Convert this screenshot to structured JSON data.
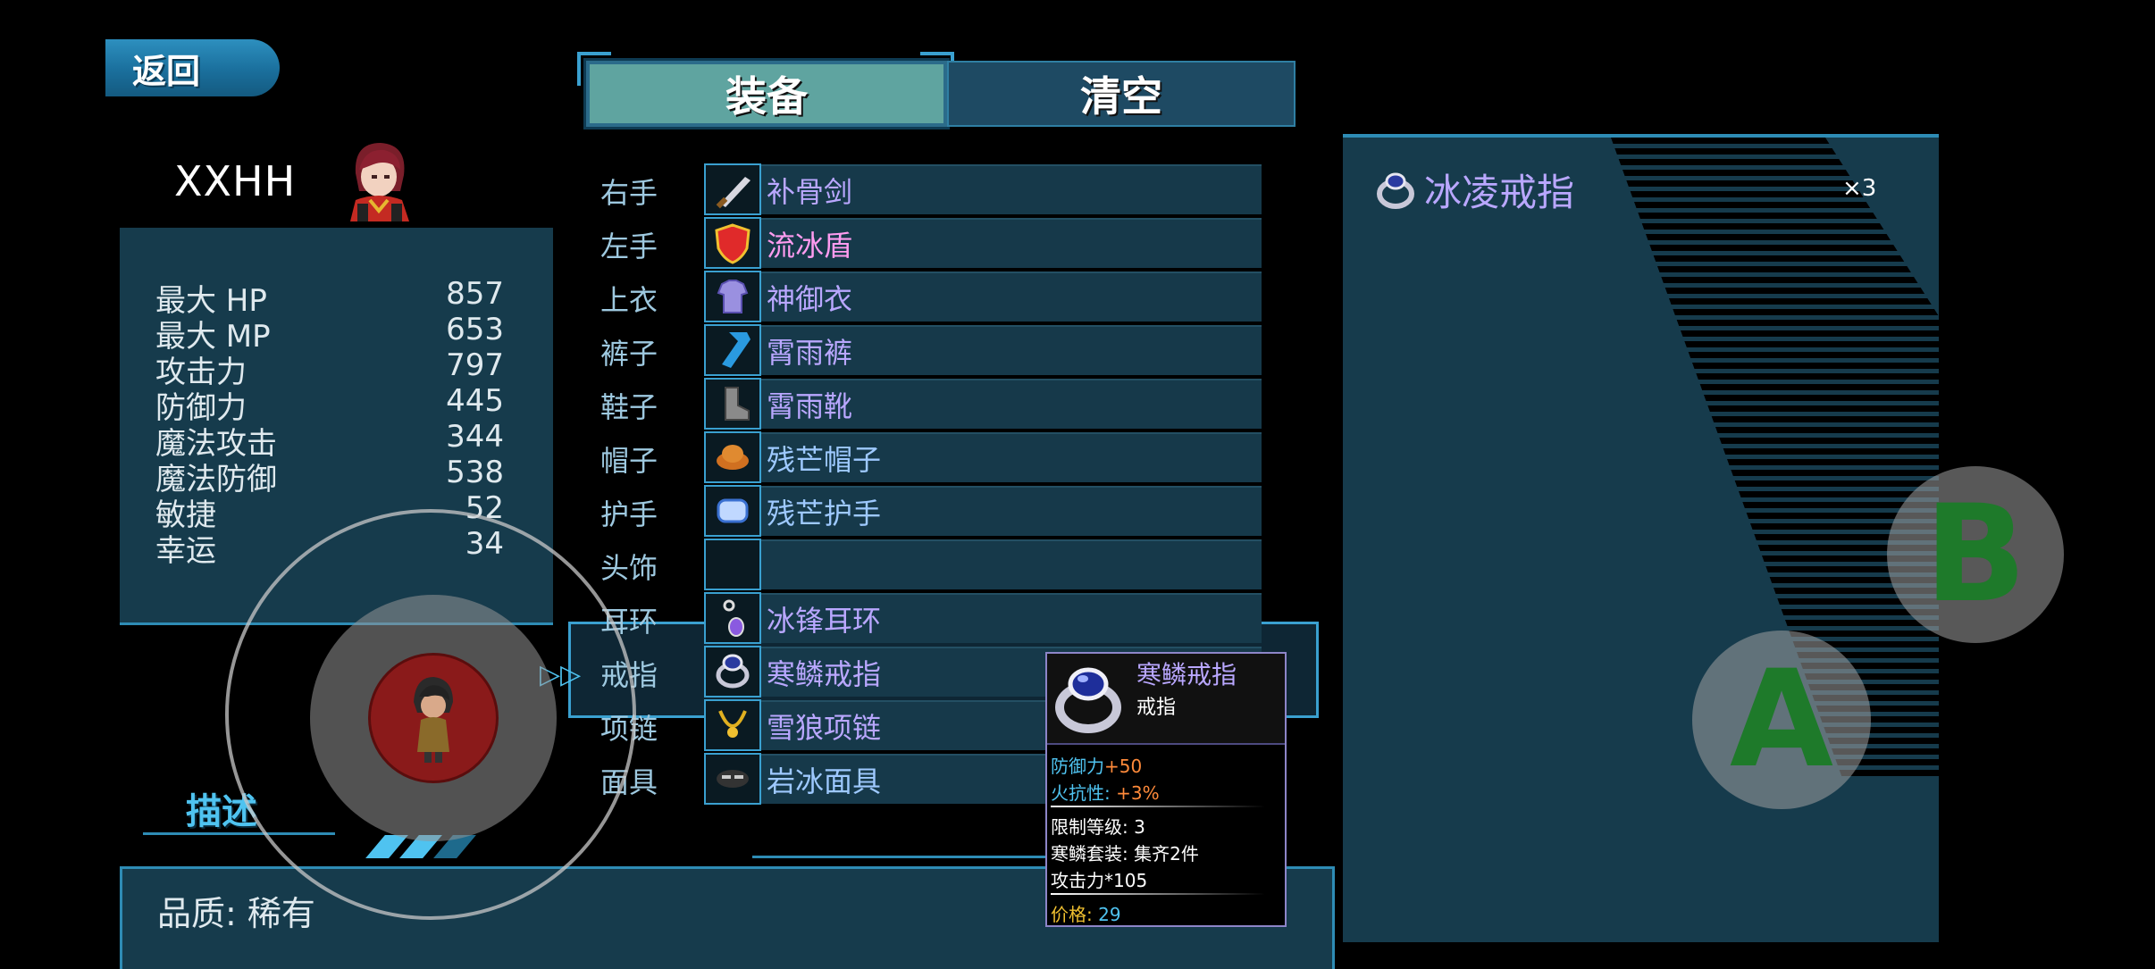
{
  "nav": {
    "back_label": "返回"
  },
  "tabs": {
    "equip_label": "装备",
    "clear_label": "清空"
  },
  "character": {
    "name": "XXHH",
    "stats": [
      {
        "label": "最大 HP",
        "value": "857"
      },
      {
        "label": "最大 MP",
        "value": "653"
      },
      {
        "label": "攻击力",
        "value": "797"
      },
      {
        "label": "防御力",
        "value": "445"
      },
      {
        "label": "魔法攻击",
        "value": "344"
      },
      {
        "label": "魔法防御",
        "value": "538"
      },
      {
        "label": "敏捷",
        "value": "52"
      },
      {
        "label": "幸运",
        "value": "34"
      }
    ]
  },
  "equipment": {
    "slots": [
      {
        "slot": "右手",
        "item": "补骨剑",
        "icon": "sword-icon"
      },
      {
        "slot": "左手",
        "item": "流冰盾",
        "icon": "shield-icon"
      },
      {
        "slot": "上衣",
        "item": "神御衣",
        "icon": "armor-icon"
      },
      {
        "slot": "裤子",
        "item": "霄雨裤",
        "icon": "pants-icon"
      },
      {
        "slot": "鞋子",
        "item": "霄雨靴",
        "icon": "boots-icon"
      },
      {
        "slot": "帽子",
        "item": "残芒帽子",
        "icon": "hat-icon"
      },
      {
        "slot": "护手",
        "item": "残芒护手",
        "icon": "gauntlet-icon"
      },
      {
        "slot": "头饰",
        "item": "",
        "icon": ""
      },
      {
        "slot": "耳环",
        "item": "冰锋耳环",
        "icon": "earring-icon"
      },
      {
        "slot": "戒指",
        "item": "寒鳞戒指",
        "icon": "ring-icon"
      },
      {
        "slot": "项链",
        "item": "雪狼项链",
        "icon": "necklace-icon"
      },
      {
        "slot": "面具",
        "item": "岩冰面具",
        "icon": "mask-icon"
      }
    ],
    "selected_slot": "戒指"
  },
  "tooltip": {
    "name": "寒鳞戒指",
    "type": "戒指",
    "stat1_label": "防御力",
    "stat1_value": "+50",
    "stat2_label": "火抗性:",
    "stat2_value": "+3%",
    "level_line": "限制等级: 3",
    "set_line": "寒鳞套装: 集齐2件",
    "bonus_line": "攻击力*105",
    "price_label": "价格:",
    "price_value": "29"
  },
  "description": {
    "title": "描述",
    "quality": "品质: 稀有"
  },
  "inventory": {
    "item_name": "冰凌戒指",
    "count": "×3"
  },
  "controls": {
    "a_label": "A",
    "b_label": "B"
  },
  "colors": {
    "panel": "#163b4c",
    "accent": "#2e8cb5",
    "item_name": "#b9a7ff",
    "rare_name": "#ff9cf0"
  }
}
